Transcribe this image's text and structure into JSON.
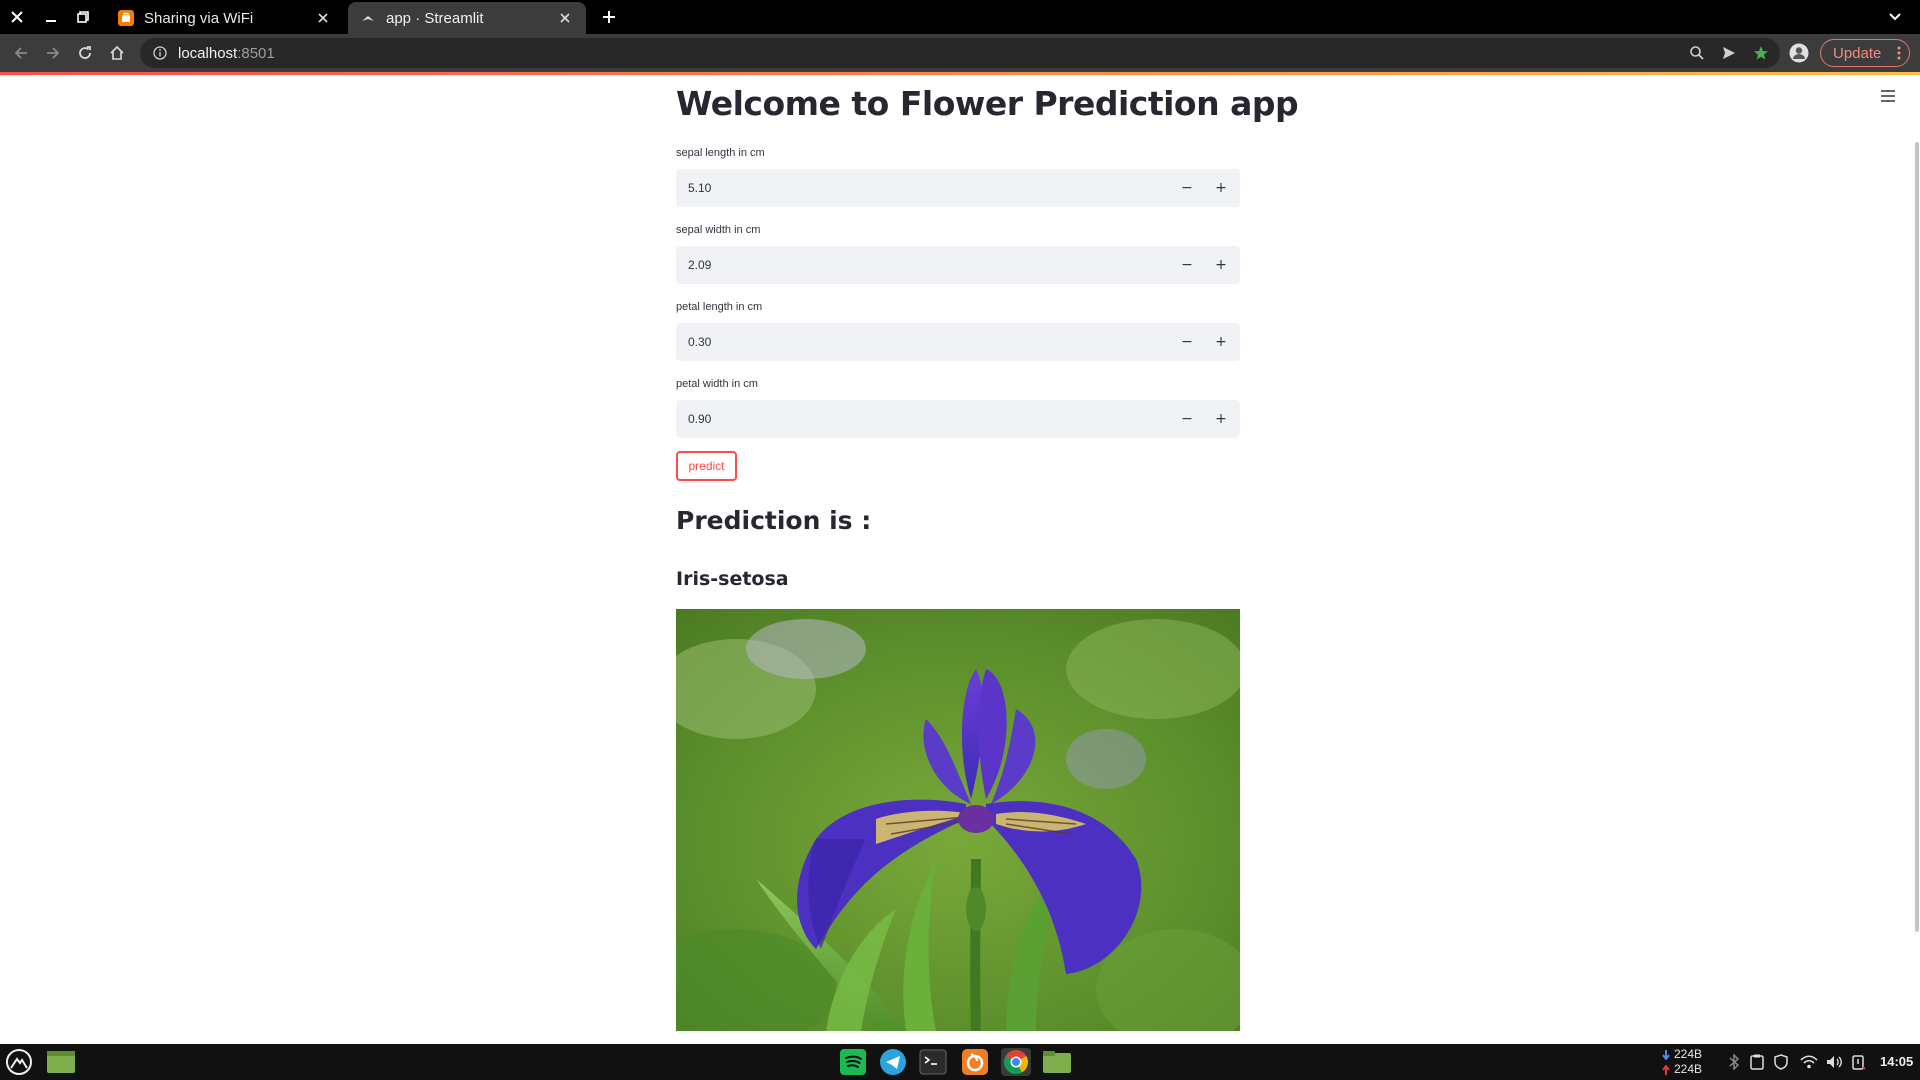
{
  "browser": {
    "tabs": [
      {
        "title": "Sharing via WiFi",
        "active": false,
        "favicon": "sharing-app-icon"
      },
      {
        "title": "app · Streamlit",
        "active": true,
        "favicon": "streamlit-icon"
      }
    ],
    "url": {
      "host": "localhost",
      "port": ":8501"
    },
    "update_label": "Update"
  },
  "app": {
    "title": "Welcome to Flower Prediction app",
    "inputs": [
      {
        "label": "sepal length in cm",
        "value": "5.10"
      },
      {
        "label": "sepal width in cm",
        "value": "2.09"
      },
      {
        "label": "petal length in cm",
        "value": "0.30"
      },
      {
        "label": "petal width in cm",
        "value": "0.90"
      }
    ],
    "step_minus": "−",
    "step_plus": "+",
    "predict_label": "predict",
    "prediction_heading": "Prediction is :",
    "prediction_result": "Iris-setosa",
    "image": "iris-flower-photo"
  },
  "taskbar": {
    "apps": [
      "spotify-icon",
      "telegram-icon",
      "terminal-icon",
      "firefox-icon",
      "chrome-icon",
      "files-icon"
    ],
    "net_down": "224B",
    "net_up": "224B",
    "clock": "14:05"
  },
  "colors": {
    "accent": "#ff4b4b",
    "input_bg": "#f0f2f6",
    "text": "#262730",
    "browser_dark": "#3c3c3c"
  }
}
